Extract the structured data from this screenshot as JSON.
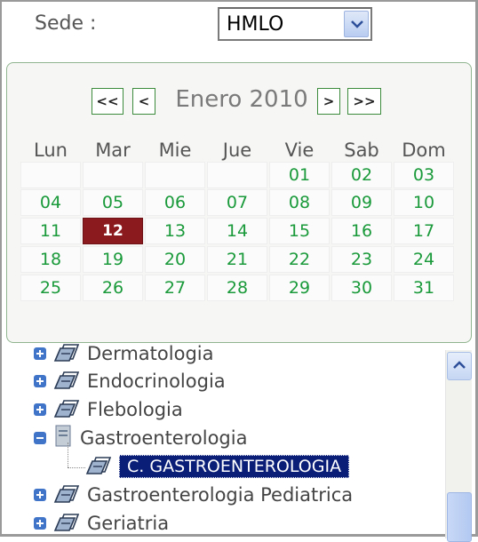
{
  "sede": {
    "label": "Sede :",
    "value": "HMLO"
  },
  "calendar": {
    "nav": {
      "prev_year": "<<",
      "prev_month": "<",
      "next_month": ">",
      "next_year": ">>"
    },
    "title": "Enero 2010",
    "weekdays": [
      "Lun",
      "Mar",
      "Mie",
      "Jue",
      "Vie",
      "Sab",
      "Dom"
    ],
    "weeks": [
      [
        "",
        "",
        "",
        "",
        "01",
        "02",
        "03"
      ],
      [
        "04",
        "05",
        "06",
        "07",
        "08",
        "09",
        "10"
      ],
      [
        "11",
        "12",
        "13",
        "14",
        "15",
        "16",
        "17"
      ],
      [
        "18",
        "19",
        "20",
        "21",
        "22",
        "23",
        "24"
      ],
      [
        "25",
        "26",
        "27",
        "28",
        "29",
        "30",
        "31"
      ]
    ],
    "selected_day": "12",
    "colors": {
      "day_text": "#1a9a3a",
      "selected_bg": "#8b1a1f",
      "border": "#8fb48f"
    }
  },
  "tree": {
    "items": [
      {
        "label": "Dermatologia",
        "expander": "plus",
        "icon": "book-icon"
      },
      {
        "label": "Endocrinologia",
        "expander": "plus",
        "icon": "book-icon"
      },
      {
        "label": "Flebologia",
        "expander": "plus",
        "icon": "book-icon"
      },
      {
        "label": "Gastroenterologia",
        "expander": "minus",
        "icon": "document-icon"
      },
      {
        "label": "C. GASTROENTEROLOGIA",
        "expander": "none",
        "icon": "book-icon",
        "selected": true
      },
      {
        "label": "Gastroenterologia Pediatrica",
        "expander": "plus",
        "icon": "book-icon"
      },
      {
        "label": "Geriatria",
        "expander": "plus",
        "icon": "book-icon"
      }
    ],
    "selected_color": "#0a1e78"
  }
}
